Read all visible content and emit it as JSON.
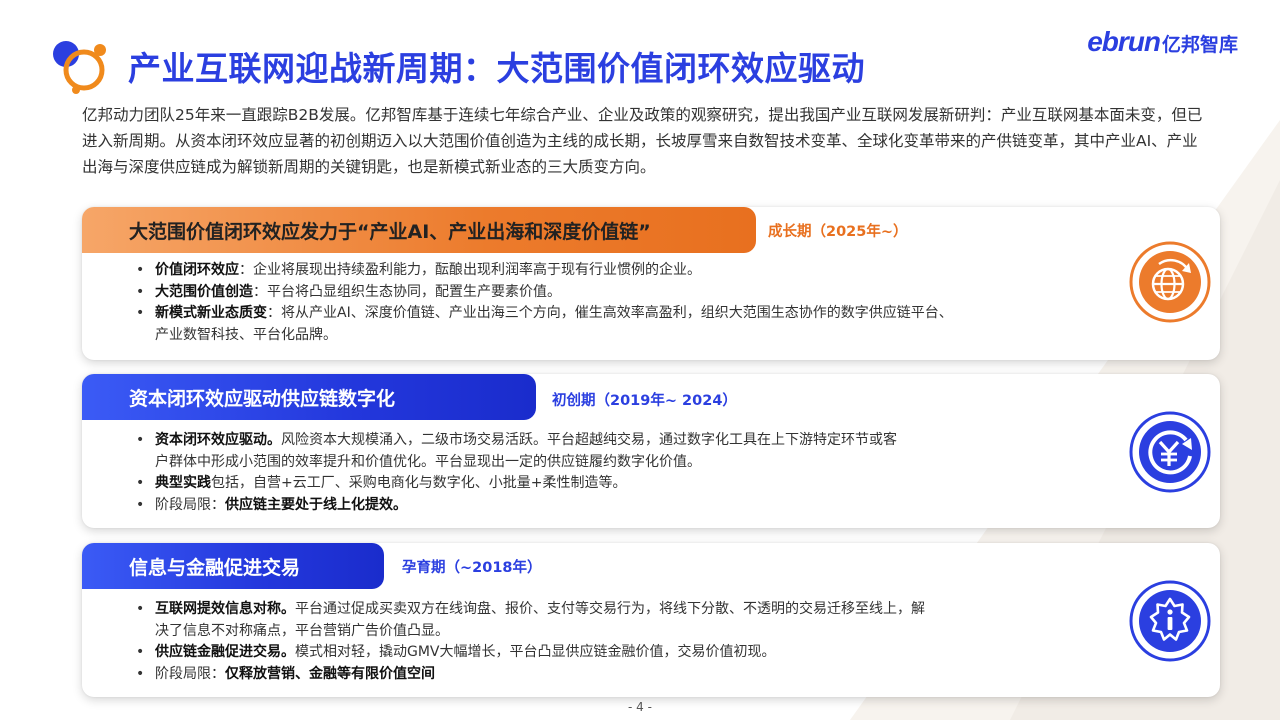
{
  "header": {
    "title": "产业互联网迎战新周期：大范围价值闭环效应驱动",
    "brand_en": "ebrun",
    "brand_cn": "亿邦智库"
  },
  "intro": "亿邦动力团队25年来一直跟踪B2B发展。亿邦智库基于连续七年综合产业、企业及政策的观察研究，提出我国产业互联网发展新研判：产业互联网基本面未变，但已进入新周期。从资本闭环效应显著的初创期迈入以大范围价值创造为主线的成长期，长坡厚雪来自数智技术变革、全球化变革带来的产供链变革，其中产业AI、产业出海与深度供应链成为解锁新周期的关键钥匙，也是新模式新业态的三大质变方向。",
  "cards": [
    {
      "title": "大范围价值闭环效应发力于“产业AI、产业出海和深度价值链”",
      "period": "成长期（2025年~）",
      "icon": "globe-refresh-icon",
      "bullets": [
        {
          "bold": "价值闭环效应",
          "text": "：企业将展现出持续盈利能力，酝酿出现利润率高于现有行业惯例的企业。"
        },
        {
          "bold": "大范围价值创造",
          "text": "：平台将凸显组织生态协同，配置生产要素价值。"
        },
        {
          "bold": "新模式新业态质变",
          "text": "：将从产业AI、深度价值链、产业出海三个方向，催生高效率高盈利，组织大范围生态协作的数字供应链平台、",
          "cont": "产业数智科技、平台化品牌。"
        }
      ]
    },
    {
      "title": "资本闭环效应驱动供应链数字化",
      "period": "初创期（2019年~ 2024）",
      "icon": "yen-cycle-icon",
      "bullets": [
        {
          "bold": "资本闭环效应驱动。",
          "text": "风险资本大规模涌入，二级市场交易活跃。平台超越纯交易，通过数字化工具在上下游特定环节或客",
          "cont": "户群体中形成小范围的效率提升和价值优化。平台显现出一定的供应链履约数字化价值。"
        },
        {
          "bold": "典型实践",
          "text": "包括，自营+云工厂、采购电商化与数字化、小批量+柔性制造等。"
        },
        {
          "pre": "阶段局限：",
          "bold": "供应链主要处于线上化提效。",
          "text": ""
        }
      ]
    },
    {
      "title": "信息与金融促进交易",
      "period": "孕育期（~2018年）",
      "icon": "info-badge-icon",
      "bullets": [
        {
          "bold": "互联网提效信息对称。",
          "text": "平台通过促成买卖双方在线询盘、报价、支付等交易行为，将线下分散、不透明的交易迁移至线上，解",
          "cont": "决了信息不对称痛点，平台营销广告价值凸显。"
        },
        {
          "bold": "供应链金融促进交易。",
          "text": "模式相对轻，撬动GMV大幅增长，平台凸显供应链金融价值，交易价值初现。"
        },
        {
          "pre": "阶段局限：",
          "bold": "仅释放营销、金融等有限价值空间",
          "text": ""
        }
      ]
    }
  ],
  "page_number": "- 4 -",
  "colors": {
    "brand_blue": "#2b3fe0",
    "accent_orange": "#e8701f"
  }
}
